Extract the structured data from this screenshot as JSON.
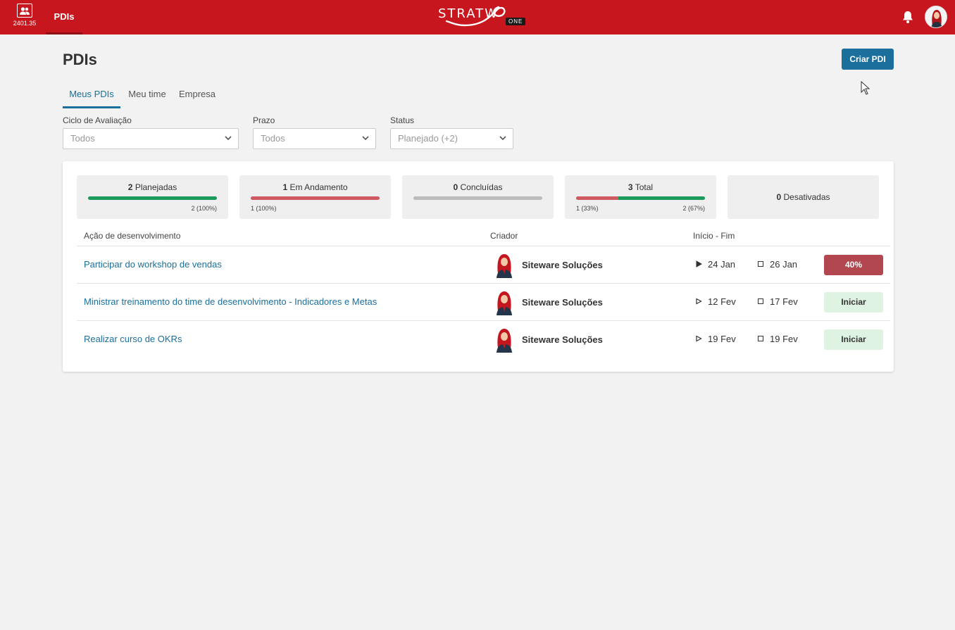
{
  "topbar": {
    "app_version": "2401.35",
    "nav_tab": "PDIs",
    "logo_text": "STRATW",
    "logo_badge": "ONE",
    "bar_color": "#c8161e"
  },
  "page": {
    "title": "PDIs",
    "create_button": "Criar PDI"
  },
  "tabs": [
    {
      "label": "Meus PDIs",
      "active": true
    },
    {
      "label": "Meu time",
      "active": false
    },
    {
      "label": "Empresa",
      "active": false
    }
  ],
  "filters": [
    {
      "label": "Ciclo de Avaliação",
      "value": "Todos"
    },
    {
      "label": "Prazo",
      "value": "Todos"
    },
    {
      "label": "Status",
      "value": "Planejado (+2)"
    }
  ],
  "stats": {
    "planned": {
      "count": "2",
      "label": "Planejadas",
      "right": "2 (100%)",
      "fill": 1.0,
      "color": "#1c9a5b"
    },
    "in_progress": {
      "count": "1",
      "label": "Em Andamento",
      "left": "1 (100%)",
      "fill": 1.0,
      "color": "#cf5a61"
    },
    "done": {
      "count": "0",
      "label": "Concluídas",
      "fill": 0,
      "color": "#bbbbbb"
    },
    "total": {
      "count": "3",
      "label": "Total",
      "left": "1 (33%)",
      "right": "2 (67%)",
      "red_fraction": 0.33,
      "green_fraction": 0.67
    },
    "disabled": {
      "count": "0",
      "label": "Desativadas"
    }
  },
  "table": {
    "headers": {
      "action": "Ação de desenvolvimento",
      "creator": "Criador",
      "dates": "Início - Fim"
    },
    "rows": [
      {
        "title": "Participar do workshop de vendas",
        "creator": "Siteware Soluções",
        "start": "24 Jan",
        "end": "26 Jan",
        "action": "40%",
        "action_type": "progress",
        "started": true
      },
      {
        "title": "Ministrar treinamento do time de desenvolvimento - Indicadores e Metas",
        "creator": "Siteware Soluções",
        "start": "12 Fev",
        "end": "17 Fev",
        "action": "Iniciar",
        "action_type": "start",
        "started": false
      },
      {
        "title": "Realizar curso de OKRs",
        "creator": "Siteware Soluções",
        "start": "19 Fev",
        "end": "19 Fev",
        "action": "Iniciar",
        "action_type": "start",
        "started": false
      }
    ]
  }
}
